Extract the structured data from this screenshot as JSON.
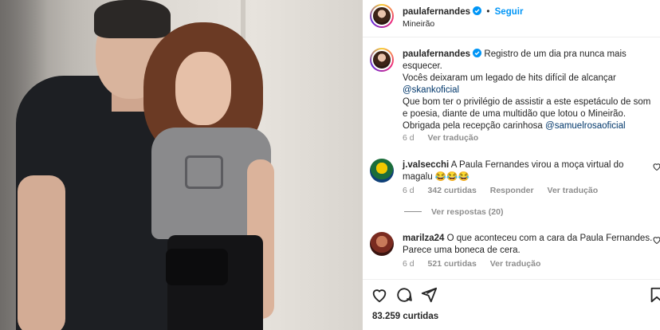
{
  "post": {
    "username": "paulafernandes",
    "follow_label": "Seguir",
    "location": "Mineirão"
  },
  "caption": {
    "username": "paulafernandes",
    "line1": "Registro de um dia pra nunca mais esquecer.",
    "line2": "Vocês deixaram um legado de hits difícil de alcançar",
    "mention1": "@skankoficial",
    "line3": "Que bom ter o privilégio de assistir a este espetáculo de som e poesia, diante de uma multidão que lotou o Mineirão.",
    "line4": "Obrigada pela recepção carinhosa",
    "mention2": "@samuelrosaoficial",
    "time": "6 d",
    "translate": "Ver tradução"
  },
  "comments": [
    {
      "username": "j.valsecchi",
      "text": "A Paula Fernandes virou a moça virtual do magalu 😂😂😂",
      "time": "6 d",
      "likes": "342 curtidas",
      "reply": "Responder",
      "translate": "Ver tradução",
      "replies_label": "Ver respostas (20)"
    },
    {
      "username": "marilza24",
      "text": "O que aconteceu com a cara da Paula Fernandes. Parece uma boneca de cera.",
      "time": "6 d",
      "likes": "521 curtidas",
      "translate": "Ver tradução"
    }
  ],
  "footer": {
    "likes": "83.259 curtidas"
  },
  "icons": [
    "verified-icon",
    "heart-icon",
    "comment-icon",
    "share-icon",
    "bookmark-icon"
  ],
  "colors": {
    "link": "#0095f6",
    "mention": "#00376b",
    "muted": "#8e8e8e",
    "text": "#262626"
  }
}
